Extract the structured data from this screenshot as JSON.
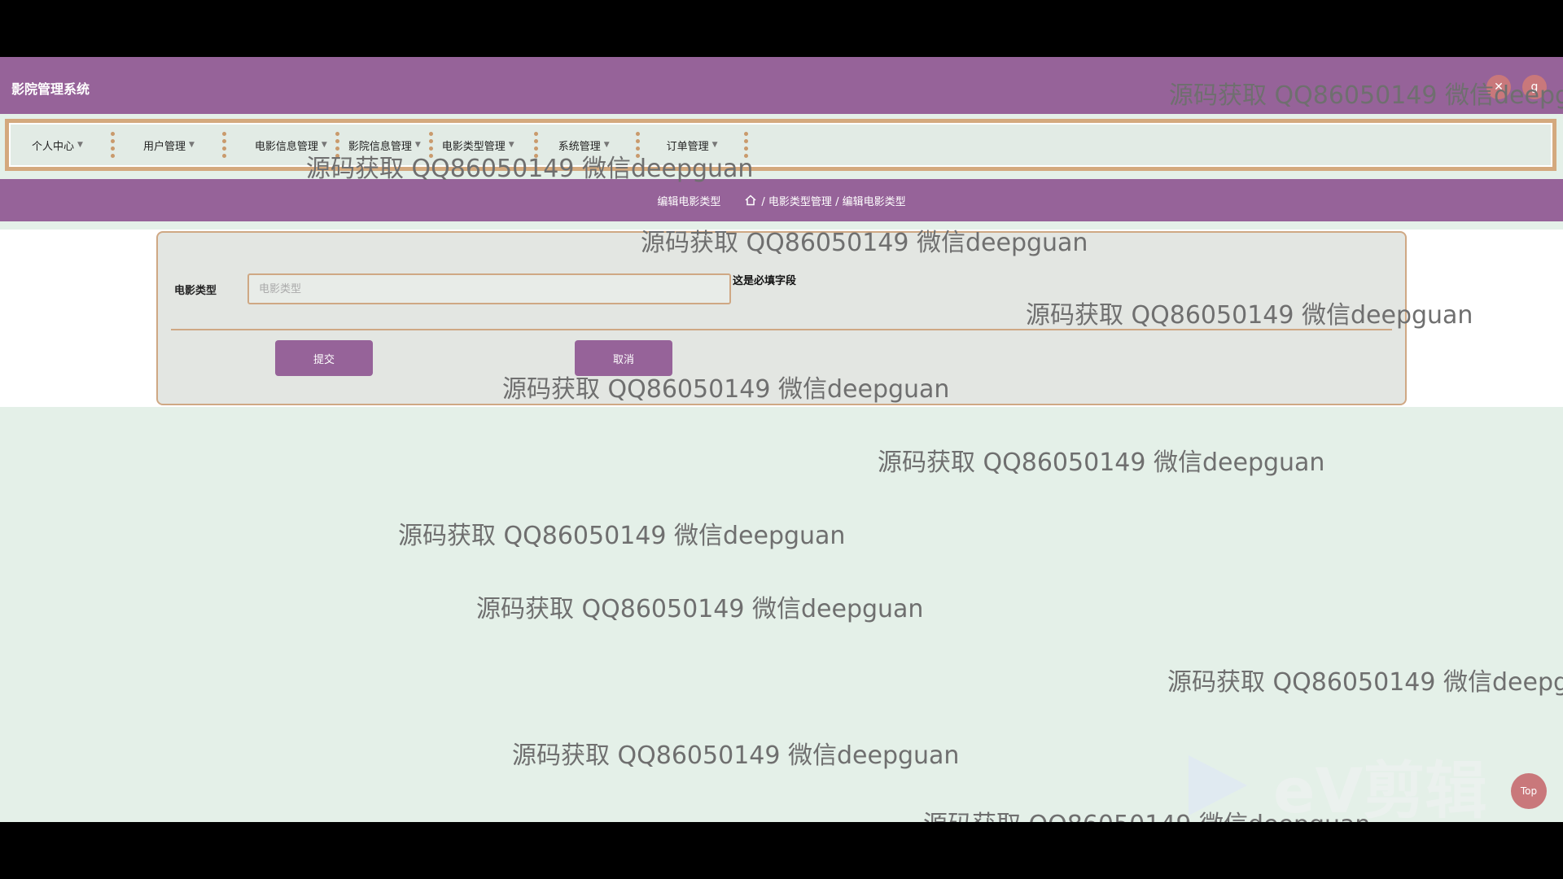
{
  "header": {
    "app_title": "影院管理系统",
    "icon1": "✕",
    "icon2": "g"
  },
  "nav": {
    "items": [
      {
        "label": "个人中心"
      },
      {
        "label": "用户管理"
      },
      {
        "label": "电影信息管理"
      },
      {
        "label": "影院信息管理"
      },
      {
        "label": "电影类型管理"
      },
      {
        "label": "系统管理"
      },
      {
        "label": "订单管理"
      }
    ]
  },
  "breadcrumb": {
    "page_title": "编辑电影类型",
    "path": "/ 电影类型管理 / 编辑电影类型",
    "home_icon": "home-icon"
  },
  "form": {
    "field_label": "电影类型",
    "field_placeholder": "电影类型",
    "field_value": "",
    "required_note": "这是必填字段",
    "submit_label": "提交",
    "cancel_label": "取消"
  },
  "watermark": "源码获取 QQ86050149 微信deepguan",
  "ev_logo_text": "eV剪辑",
  "top_button_label": "Top",
  "colors": {
    "header": "#966399",
    "accent_border": "#cfa884",
    "background": "#e4f0e8"
  }
}
